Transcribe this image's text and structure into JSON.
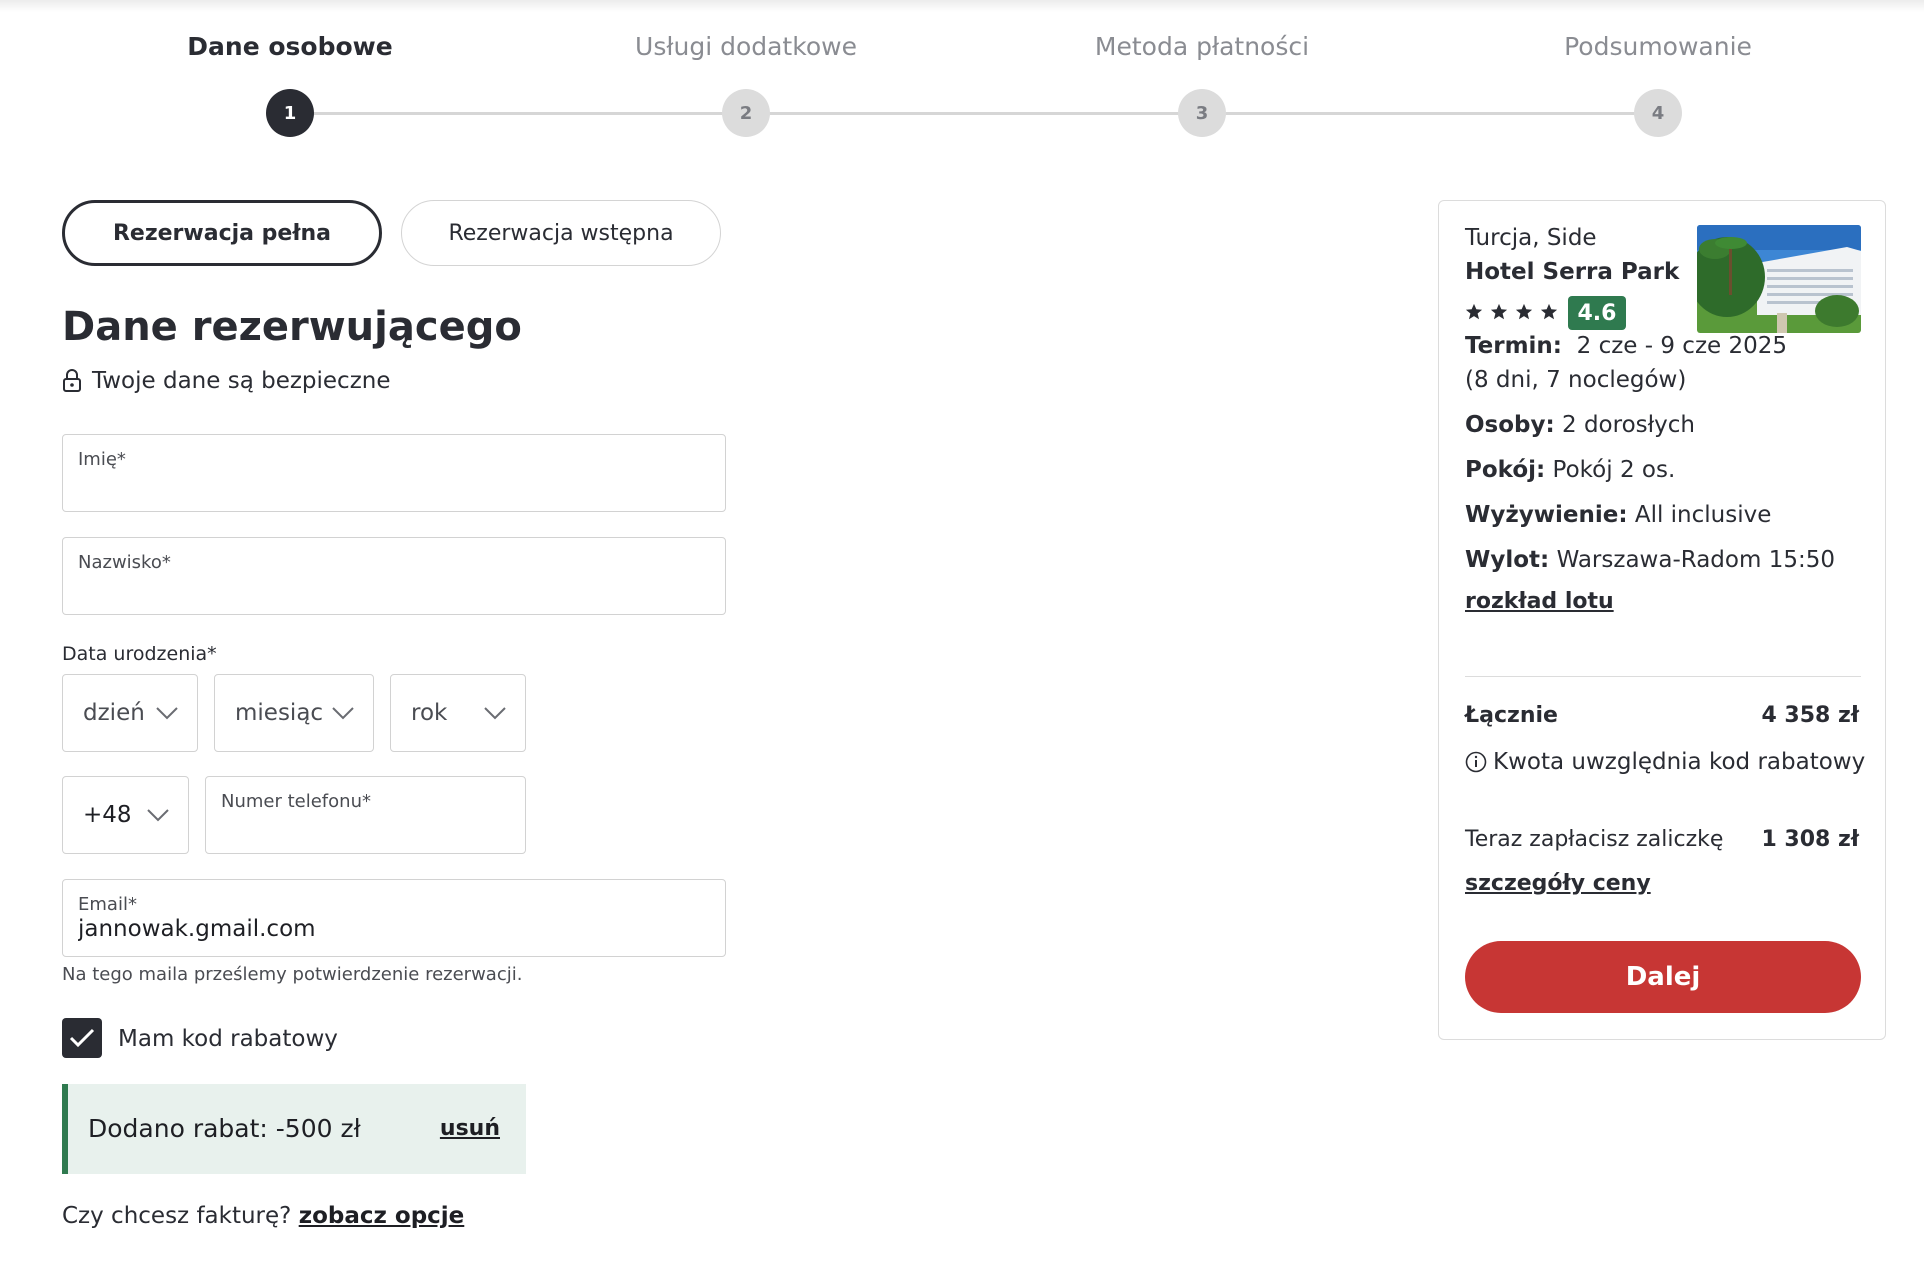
{
  "stepper": {
    "steps": [
      {
        "label": "Dane osobowe",
        "number": "1",
        "active": true
      },
      {
        "label": "Usługi dodatkowe",
        "number": "2",
        "active": false
      },
      {
        "label": "Metoda płatności",
        "number": "3",
        "active": false
      },
      {
        "label": "Podsumowanie",
        "number": "4",
        "active": false
      }
    ]
  },
  "booking_type": {
    "full_label": "Rezerwacja pełna",
    "preliminary_label": "Rezerwacja wstępna",
    "selected": "full"
  },
  "form": {
    "title": "Dane rezerwującego",
    "secure_note": "Twoje dane są bezpieczne",
    "first_name_label": "Imię*",
    "first_name_value": "",
    "last_name_label": "Nazwisko*",
    "last_name_value": "",
    "birth_date_label": "Data urodzenia*",
    "day_placeholder": "dzień",
    "month_placeholder": "miesiąc",
    "year_placeholder": "rok",
    "phone_prefix": "+48",
    "phone_label": "Numer telefonu*",
    "phone_value": "",
    "email_label": "Email*",
    "email_value": "jannowak.gmail.com",
    "email_hint": "Na tego maila prześlemy potwierdzenie rezerwacji.",
    "discount_checkbox_label": "Mam kod rabatowy",
    "discount_checked": true,
    "discount_added": "Dodano rabat: -500 zł",
    "discount_remove": "usuń",
    "invoice_question": "Czy chcesz fakturę?",
    "invoice_link": "zobacz opcje"
  },
  "summary": {
    "location": "Turcja, Side",
    "hotel_name": "Hotel Serra Park",
    "stars": 4,
    "rating": "4.6",
    "term_label": "Termin:",
    "term_value": "2 cze - 9 cze 2025",
    "term_duration": "(8 dni, 7 noclegów)",
    "persons_label": "Osoby:",
    "persons_value": "2 dorosłych",
    "room_label": "Pokój:",
    "room_value": "Pokój 2 os.",
    "board_label": "Wyżywienie:",
    "board_value": "All inclusive",
    "flight_label": "Wylot:",
    "flight_value": "Warszawa-Radom 15:50",
    "flight_schedule_link": "rozkład lotu",
    "total_label": "Łącznie",
    "total_value": "4 358 zł",
    "discount_note": "Kwota uwzględnia kod rabatowy",
    "deposit_label": "Teraz zapłacisz zaliczkę",
    "deposit_value": "1 308 zł",
    "price_details_link": "szczegóły ceny",
    "next_button": "Dalej"
  },
  "colors": {
    "dark": "#2a2c33",
    "accent_red": "#c73634",
    "rating_green": "#2f7a4f",
    "discount_bg": "#e8f1ed"
  }
}
